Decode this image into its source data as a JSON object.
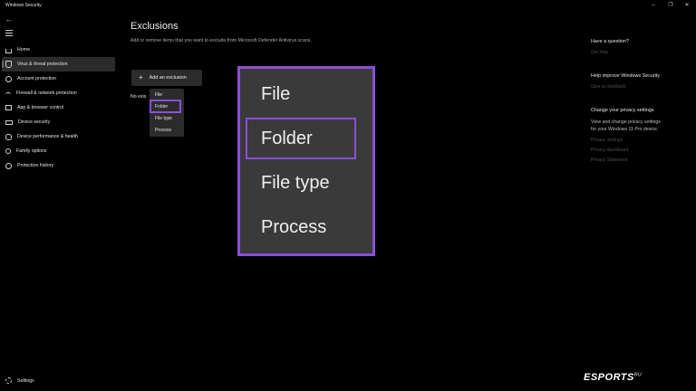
{
  "window": {
    "title": "Windows Security",
    "controls": [
      "–",
      "❐",
      "✕"
    ]
  },
  "nav": {
    "back_icon": "back-arrow-icon",
    "menu_icon": "hamburger-icon",
    "items": [
      {
        "label": "Home",
        "icon": "home-icon",
        "selected": false
      },
      {
        "label": "Virus & threat protection",
        "icon": "shield-icon",
        "selected": true
      },
      {
        "label": "Account protection",
        "icon": "person-icon",
        "selected": false
      },
      {
        "label": "Firewall & network protection",
        "icon": "wifi-icon",
        "selected": false
      },
      {
        "label": "App & browser control",
        "icon": "window-icon",
        "selected": false
      },
      {
        "label": "Device security",
        "icon": "laptop-icon",
        "selected": false
      },
      {
        "label": "Device performance & health",
        "icon": "heart-icon",
        "selected": false
      },
      {
        "label": "Family options",
        "icon": "family-icon",
        "selected": false
      },
      {
        "label": "Protection history",
        "icon": "history-icon",
        "selected": false
      }
    ],
    "settings_label": "Settings"
  },
  "main": {
    "title": "Exclusions",
    "description": "Add or remove items that you want to exclude from Microsoft Defender Antivirus scans.",
    "add_button_label": "Add an exclusion",
    "no_existing_text": "No exis",
    "dropdown_options": [
      "File",
      "Folder",
      "File type",
      "Process"
    ],
    "highlighted_option": "Folder"
  },
  "zoom_panel": {
    "options": [
      "File",
      "Folder",
      "File type",
      "Process"
    ],
    "highlighted": "Folder"
  },
  "right_panel": {
    "question": {
      "heading": "Have a question?",
      "link": "Get help"
    },
    "improve": {
      "heading": "Help improve Windows Security",
      "link": "Give us feedback"
    },
    "privacy": {
      "heading": "Change your privacy settings",
      "text_line1": "View and change privacy settings",
      "text_line2": "for your Windows 11 Pro device.",
      "links": [
        "Privacy settings",
        "Privacy dashboard",
        "Privacy Statement"
      ]
    }
  },
  "watermark": {
    "text": "ESPORTS",
    "suffix": "RU"
  },
  "colors": {
    "accent_highlight": "#8a4fd8",
    "background": "#000000",
    "panel": "#2b2b2b"
  }
}
